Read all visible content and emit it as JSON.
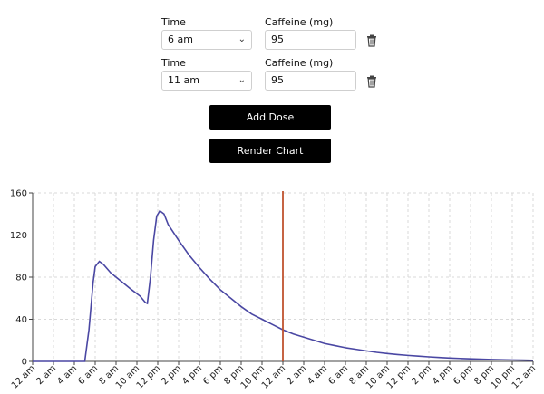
{
  "doses": [
    {
      "time_label": "Time",
      "caffeine_label": "Caffeine (mg)",
      "time_value": "6 am",
      "caffeine_value": "95"
    },
    {
      "time_label": "Time",
      "caffeine_label": "Caffeine (mg)",
      "time_value": "11 am",
      "caffeine_value": "95"
    }
  ],
  "buttons": {
    "add_dose": "Add Dose",
    "render_chart": "Render Chart"
  },
  "icons": {
    "select_chevron": "chevron-down-icon",
    "delete": "trash-icon"
  },
  "chart_data": {
    "type": "line",
    "xlabel": "",
    "ylabel": "",
    "ylim": [
      0,
      160
    ],
    "y_ticks": [
      0,
      40,
      80,
      120,
      160
    ],
    "x_tick_labels": [
      "12 am",
      "2 am",
      "4 am",
      "6 am",
      "8 am",
      "10 am",
      "12 pm",
      "2 pm",
      "4 pm",
      "6 pm",
      "8 pm",
      "10 pm",
      "12 am",
      "2 am",
      "4 am",
      "6 am",
      "8 am",
      "10 am",
      "12 pm",
      "2 pm",
      "4 pm",
      "6 pm",
      "8 pm",
      "10 pm",
      "12 am"
    ],
    "x_unit": "hours since first 12 am",
    "xlim": [
      0,
      48
    ],
    "grid": true,
    "series": [
      {
        "color": "#4a47a3",
        "points": [
          [
            0,
            0
          ],
          [
            5,
            0
          ],
          [
            5.4,
            30
          ],
          [
            5.8,
            75
          ],
          [
            6,
            90
          ],
          [
            6.4,
            95
          ],
          [
            6.8,
            92
          ],
          [
            7.5,
            84
          ],
          [
            8.5,
            76
          ],
          [
            9.5,
            68
          ],
          [
            10.3,
            62
          ],
          [
            10.8,
            56
          ],
          [
            11,
            55
          ],
          [
            11.3,
            80
          ],
          [
            11.6,
            115
          ],
          [
            11.9,
            138
          ],
          [
            12.2,
            143
          ],
          [
            12.6,
            140
          ],
          [
            13,
            130
          ],
          [
            14,
            115
          ],
          [
            15,
            101
          ],
          [
            16,
            89
          ],
          [
            17,
            78
          ],
          [
            18,
            68
          ],
          [
            19,
            60
          ],
          [
            20,
            52
          ],
          [
            21,
            45
          ],
          [
            22,
            40
          ],
          [
            23,
            35
          ],
          [
            24,
            30
          ],
          [
            25,
            26
          ],
          [
            26,
            23
          ],
          [
            27,
            20
          ],
          [
            28,
            17
          ],
          [
            29,
            15
          ],
          [
            30,
            13
          ],
          [
            31,
            11.5
          ],
          [
            32,
            10
          ],
          [
            33,
            8.6
          ],
          [
            34,
            7.5
          ],
          [
            35,
            6.5
          ],
          [
            36,
            5.7
          ],
          [
            37,
            5
          ],
          [
            38,
            4.3
          ],
          [
            39,
            3.7
          ],
          [
            40,
            3.2
          ],
          [
            41,
            2.8
          ],
          [
            42,
            2.4
          ],
          [
            43,
            2.1
          ],
          [
            44,
            1.8
          ],
          [
            45,
            1.6
          ],
          [
            46,
            1.4
          ],
          [
            47,
            1.2
          ],
          [
            48,
            1.0
          ]
        ]
      }
    ],
    "marker": {
      "x": 24,
      "color": "#c0532f"
    }
  }
}
